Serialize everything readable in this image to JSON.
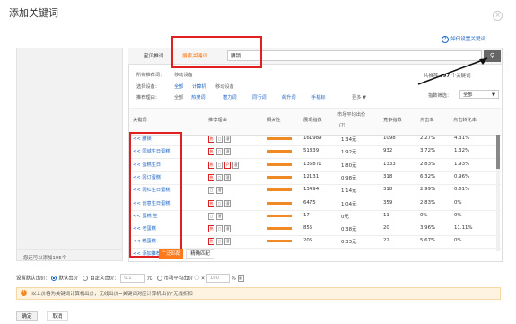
{
  "dialog": {
    "title": "添加关键词",
    "close": "×"
  },
  "help_link": "如何设置关键词",
  "tabs": {
    "tab1": "宝贝推词",
    "tab2": "搜索关键词"
  },
  "search": {
    "value": "腰锁",
    "button_icon": "search-icon"
  },
  "filters": {
    "all_recommend_label": "所有推荐词：",
    "all_recommend_value": "移动设备",
    "device_label": "选择设备：",
    "devices": [
      "全部",
      "计算机",
      "移动设备"
    ],
    "reason_label": "推荐理由：",
    "reasons": [
      "全部",
      "热搜词",
      "潜力词",
      "同行词",
      "飙升词",
      "手机标"
    ],
    "more": "更多"
  },
  "result_count": {
    "prefix": "共推荐",
    "count": "797",
    "suffix": "个关键词"
  },
  "index_filter": {
    "label": "指数筛选：",
    "value": "全部"
  },
  "table": {
    "headers": {
      "keyword": "关键词",
      "reason": "推荐理由",
      "relevance": "相关性",
      "search_index": "展现指数",
      "avg_bid_line1": "市场平均出价",
      "avg_bid_line2": "(?)",
      "competition": "竞争指数",
      "ctr": "点击率",
      "cvr": "点击转化率"
    },
    "rows": [
      {
        "keyword": "腰锁",
        "search_index": "161989",
        "avg_bid": "1.34元",
        "competition": "1098",
        "ctr": "2.27%",
        "cvr": "4.31%"
      },
      {
        "keyword": "同城生日蛋糕",
        "search_index": "51839",
        "avg_bid": "1.92元",
        "competition": "932",
        "ctr": "3.72%",
        "cvr": "1.32%"
      },
      {
        "keyword": "蛋糕生日",
        "search_index": "135871",
        "avg_bid": "1.80元",
        "competition": "1333",
        "ctr": "2.83%",
        "cvr": "1.93%"
      },
      {
        "keyword": "冈订蛋糕",
        "search_index": "12131",
        "avg_bid": "0.98元",
        "competition": "318",
        "ctr": "6.32%",
        "cvr": "0.96%"
      },
      {
        "keyword": "冈红生日蛋糕",
        "search_index": "13494",
        "avg_bid": "1.14元",
        "competition": "318",
        "ctr": "2.99%",
        "cvr": "0.61%"
      },
      {
        "keyword": "创意生日蛋糕",
        "search_index": "6475",
        "avg_bid": "1.04元",
        "competition": "359",
        "ctr": "2.83%",
        "cvr": "0%"
      },
      {
        "keyword": "蛋糕 生",
        "search_index": "17",
        "avg_bid": "0元",
        "competition": "11",
        "ctr": "0%",
        "cvr": "0%"
      },
      {
        "keyword": "老蛋糕",
        "search_index": "855",
        "avg_bid": "0.38元",
        "competition": "20",
        "ctr": "3.96%",
        "cvr": "11.11%"
      },
      {
        "keyword": "糕蛋糕",
        "search_index": "205",
        "avg_bid": "0.33元",
        "competition": "22",
        "ctr": "5.67%",
        "cvr": "0%"
      }
    ],
    "add_all": "添加推荐词"
  },
  "left_panel": {
    "footer": "您还可以添加195个"
  },
  "bottom_tabs": {
    "tab1": "广泛匹配",
    "tab2": "精确匹配"
  },
  "bid": {
    "label": "设置默认出价：",
    "default": "默认出价",
    "custom": "自定义出价：",
    "custom_value": "0.1",
    "unit_yuan": "元",
    "market": "市场平均出价",
    "times": "×",
    "pct_value": "100",
    "pct": "%"
  },
  "notice": "以上价格为关键词计算机出价，无线出价=关键词对应计算机出价*无线折扣",
  "buttons": {
    "confirm": "确定",
    "cancel": "取消"
  },
  "colors": {
    "accent": "#ff7a1a",
    "link": "#1f66c6",
    "highlight": "#e02020"
  }
}
